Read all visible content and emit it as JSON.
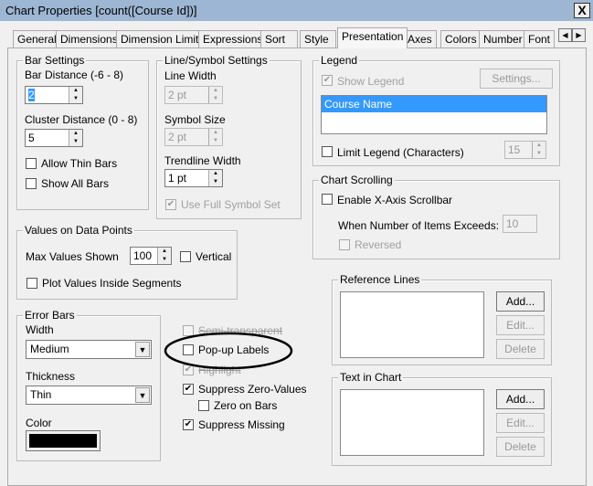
{
  "window": {
    "title": "Chart Properties [count([Course Id])]",
    "close": "X"
  },
  "tabs": [
    "General",
    "Dimensions",
    "Dimension Limits",
    "Expressions",
    "Sort",
    "Style",
    "Presentation",
    "Axes",
    "Colors",
    "Number",
    "Font"
  ],
  "tab_scroll": {
    "left": "◀",
    "right": "▶"
  },
  "bar_settings": {
    "title": "Bar Settings",
    "bar_distance_label": "Bar Distance (-6 - 8)",
    "bar_distance": "2",
    "cluster_distance_label": "Cluster Distance (0 - 8)",
    "cluster_distance": "5",
    "allow_thin": "Allow Thin Bars",
    "show_all": "Show All Bars"
  },
  "line_settings": {
    "title": "Line/Symbol Settings",
    "line_width_label": "Line Width",
    "line_width": "2 pt",
    "symbol_size_label": "Symbol Size",
    "symbol_size": "2 pt",
    "trendline_label": "Trendline Width",
    "trendline": "1 pt",
    "full_symbol": "Use Full Symbol Set"
  },
  "legend": {
    "title": "Legend",
    "show": "Show Legend",
    "settings": "Settings...",
    "item": "Course Name",
    "limit": "Limit Legend (Characters)",
    "limit_value": "15"
  },
  "scrolling": {
    "title": "Chart Scrolling",
    "enable": "Enable X-Axis Scrollbar",
    "exceeds_label": "When Number of Items Exceeds:",
    "exceeds": "10",
    "reversed": "Reversed"
  },
  "values": {
    "title": "Values on Data Points",
    "max_label": "Max Values Shown",
    "max": "100",
    "vertical": "Vertical",
    "inside": "Plot Values Inside Segments"
  },
  "error_bars": {
    "title": "Error Bars",
    "width_label": "Width",
    "width": "Medium",
    "thickness_label": "Thickness",
    "thickness": "Thin",
    "color_label": "Color",
    "color": "#000000"
  },
  "options": {
    "semi": "Semi-transparent",
    "popup": "Pop-up Labels",
    "highlight": "Highlight",
    "suppress_zero": "Suppress Zero-Values",
    "zero_bars": "Zero on Bars",
    "suppress_missing": "Suppress Missing"
  },
  "reference_lines": {
    "title": "Reference Lines",
    "add": "Add...",
    "edit": "Edit...",
    "delete": "Delete"
  },
  "text_in_chart": {
    "title": "Text in Chart",
    "add": "Add...",
    "edit": "Edit...",
    "delete": "Delete"
  }
}
